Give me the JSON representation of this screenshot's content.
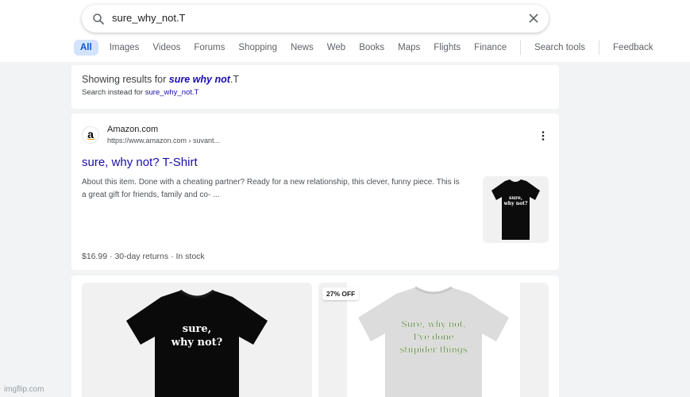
{
  "search": {
    "query": "sure_why_not.T"
  },
  "tabs": {
    "items": [
      "All",
      "Images",
      "Videos",
      "Forums",
      "Shopping",
      "News",
      "Web",
      "Books",
      "Maps",
      "Flights",
      "Finance"
    ],
    "search_tools": "Search tools",
    "feedback": "Feedback"
  },
  "spelling": {
    "prefix": "Showing results for ",
    "corrected": "sure why not",
    "suffix": ".T",
    "instead_prefix": "Search instead for ",
    "instead_query": "sure_why_not.T"
  },
  "result": {
    "favicon_letter": "a",
    "site_name": "Amazon.com",
    "site_url": "https://www.amazon.com › suvant...",
    "title": "sure, why not? T-Shirt",
    "snippet": "About this item. Done with a cheating partner? Ready for a new relationship, this clever, funny piece. This is a great gift for friends, family and co- ...",
    "price_line": "$16.99 · 30-day returns · In stock",
    "thumb_text_line1": "sure,",
    "thumb_text_line2": "why not?"
  },
  "images": {
    "tile1_line1": "sure,",
    "tile1_line2": "why not?",
    "tile2_badge": "27% OFF",
    "tile2_line1": "Sure, why not.",
    "tile2_line2": "I've done",
    "tile2_line3": "stupider things"
  },
  "watermark": "imgflip.com",
  "colors": {
    "link": "#1a0dab",
    "active_tab_bg": "#d3e3fd",
    "active_tab_text": "#0b57d0",
    "page_bg": "#f1f3f4"
  }
}
